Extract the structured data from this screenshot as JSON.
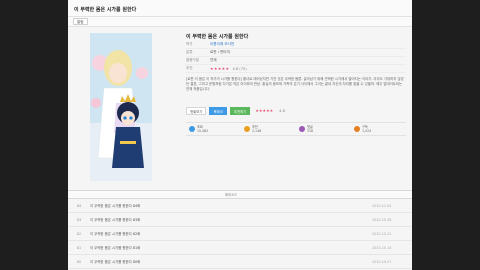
{
  "window_title": "이 무력한 몸은 시가를 원한다",
  "chip_label": "알림",
  "work": {
    "title": "이 무력한 몸은 시가를 원한다",
    "author_label": "작가",
    "author": "이름이예 모사번",
    "genre_label": "분류",
    "genre": "로판 / 판타지",
    "status_label": "발행구분",
    "status": "연재",
    "rating_label": "추천",
    "rating_stars": "★★★★★",
    "rating_value": "4.8 (75)",
    "description": "[로판 이 몸은 이 작가가 시가를 원한다] 황녀로 태어났지만 가진 것은 무력한 몸뿐. 살아남기 위해 선택한 시가에서 벌어지는 이야기. 아무도 기대하지 않았던 결혼, 그리고 운명처럼 다가온 작은 아이와의 만남. 황실의 음모와 가족의 온기 사이에서 그녀는 끝내 자신의 자리를 찾을 수 있을까. 매주 업데이트되는 연재 작품입니다."
  },
  "buttons": {
    "first_episode": "첫회보기",
    "bookmark": "북마크",
    "recommend": "추천하기",
    "star_rating": "★★★★★",
    "rating_count": "4.8"
  },
  "stats": [
    {
      "label": "조회",
      "value": "15,482",
      "color": "#3f9ae6"
    },
    {
      "label": "추천",
      "value": "2,146",
      "color": "#e8a020"
    },
    {
      "label": "댓글",
      "value": "318",
      "color": "#9b59b6"
    },
    {
      "label": "구독",
      "value": "1,024",
      "color": "#e67e22"
    }
  ],
  "list": {
    "header_title": "에피소드",
    "rows": [
      {
        "num": "84",
        "title": "이 무력한 몸은 시가를 원한다 84화",
        "date": "2020.11.04"
      },
      {
        "num": "83",
        "title": "이 무력한 몸은 시가를 원한다 83화",
        "date": "2020.10.28"
      },
      {
        "num": "82",
        "title": "이 무력한 몸은 시가를 원한다 82화",
        "date": "2020.10.21"
      },
      {
        "num": "81",
        "title": "이 무력한 몸은 시가를 원한다 81화",
        "date": "2020.10.14"
      },
      {
        "num": "80",
        "title": "이 무력한 몸은 시가를 원한다 80화",
        "date": "2020.10.07"
      }
    ]
  }
}
